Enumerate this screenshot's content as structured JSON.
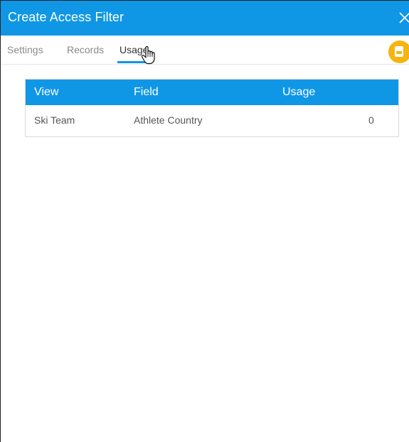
{
  "dialog": {
    "title": "Create Access Filter",
    "close_icon": "close-icon",
    "accent_color": "#0f97e6",
    "action_color": "#f5b40f"
  },
  "tabs": [
    {
      "label": "Settings",
      "active": false
    },
    {
      "label": "Records",
      "active": false
    },
    {
      "label": "Usage",
      "active": true
    }
  ],
  "fab": {
    "icon": "document-icon"
  },
  "table": {
    "headers": [
      "View",
      "Field",
      "Usage"
    ],
    "rows": [
      {
        "view": "Ski Team",
        "field": "Athlete Country",
        "usage": "0"
      }
    ]
  }
}
